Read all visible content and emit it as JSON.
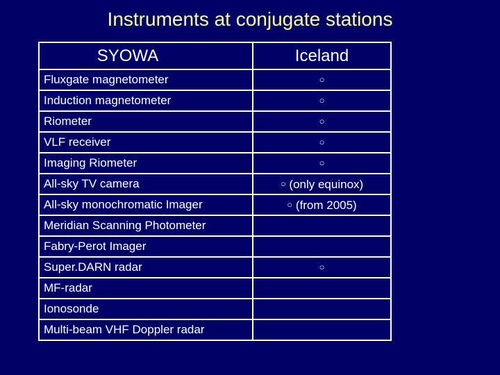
{
  "slide": {
    "title": "Instruments at conjugate stations",
    "background_color": "#000066",
    "title_color": "#ffff99",
    "text_color": "#ffffff",
    "border_color": "#ffffff"
  },
  "table": {
    "headers": [
      "SYOWA",
      "Iceland"
    ],
    "rows": [
      {
        "instrument": "Fluxgate magnetometer",
        "iceland_mark": "○",
        "iceland_note": ""
      },
      {
        "instrument": "Induction magnetometer",
        "iceland_mark": "○",
        "iceland_note": ""
      },
      {
        "instrument": "Riometer",
        "iceland_mark": "○",
        "iceland_note": ""
      },
      {
        "instrument": "VLF receiver",
        "iceland_mark": "○",
        "iceland_note": ""
      },
      {
        "instrument": "Imaging Riometer",
        "iceland_mark": "○",
        "iceland_note": ""
      },
      {
        "instrument": "All-sky TV camera",
        "iceland_mark": "○",
        "iceland_note": "(only equinox)"
      },
      {
        "instrument": "All-sky monochromatic Imager",
        "iceland_mark": "○",
        "iceland_note": "(from 2005)"
      },
      {
        "instrument": "Meridian Scanning Photometer",
        "iceland_mark": "",
        "iceland_note": ""
      },
      {
        "instrument": "Fabry-Perot Imager",
        "iceland_mark": "",
        "iceland_note": ""
      },
      {
        "instrument": "Super.DARN radar",
        "iceland_mark": "○",
        "iceland_note": ""
      },
      {
        "instrument": "MF-radar",
        "iceland_mark": "",
        "iceland_note": ""
      },
      {
        "instrument": "Ionosonde",
        "iceland_mark": "",
        "iceland_note": ""
      },
      {
        "instrument": "Multi-beam VHF Doppler radar",
        "iceland_mark": "",
        "iceland_note": ""
      }
    ]
  }
}
